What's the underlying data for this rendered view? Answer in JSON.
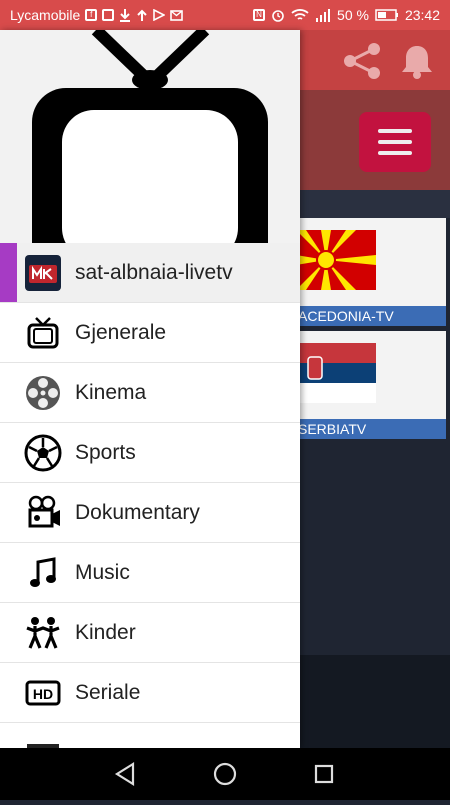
{
  "status": {
    "carrier": "Lycamobile",
    "battery": "50 %",
    "time": "23:42"
  },
  "channels": [
    {
      "name": "MACEDONIA-TV",
      "label": "ACEDONIA-TV"
    },
    {
      "name": "SERBIATV",
      "label": "SERBIATV"
    }
  ],
  "drawer": {
    "items": [
      {
        "label": "sat-albnaia-livetv",
        "icon": "app-logo-icon"
      },
      {
        "label": "Gjenerale",
        "icon": "tv-icon"
      },
      {
        "label": "Kinema",
        "icon": "film-reel-icon"
      },
      {
        "label": "Sports",
        "icon": "soccer-ball-icon"
      },
      {
        "label": "Dokumentary",
        "icon": "video-camera-icon"
      },
      {
        "label": "Music",
        "icon": "music-note-icon"
      },
      {
        "label": "Kinder",
        "icon": "kids-icon"
      },
      {
        "label": "Seriale",
        "icon": "hd-icon"
      }
    ]
  },
  "colors": {
    "status_bar": "#d84b4b",
    "accent": "#a63bc4",
    "menu_button": "#c2123f",
    "channel_label": "#3b6cb5"
  }
}
